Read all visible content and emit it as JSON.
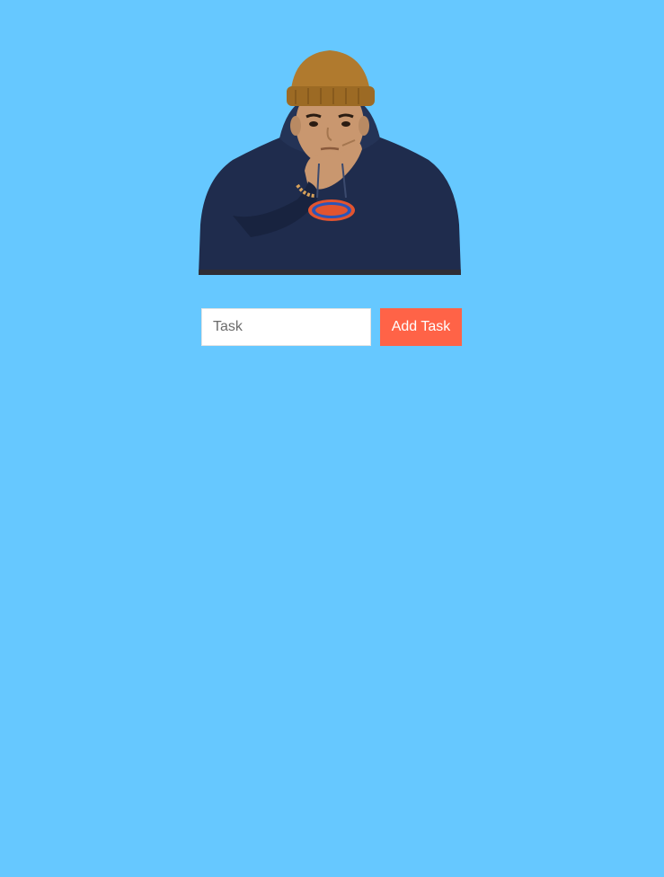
{
  "app": {
    "background_color": "#66c8ff"
  },
  "hero_image": {
    "icon": "person-thinking-illustration",
    "colors": {
      "beanie": "#b07a2e",
      "hoodie": "#1f2c4d",
      "skin": "#c9976f",
      "logo": "#e2542f"
    }
  },
  "task_form": {
    "input_placeholder": "Task",
    "input_value": "",
    "add_button_label": "Add Task",
    "add_button_color": "#ff6347"
  },
  "tasks": []
}
